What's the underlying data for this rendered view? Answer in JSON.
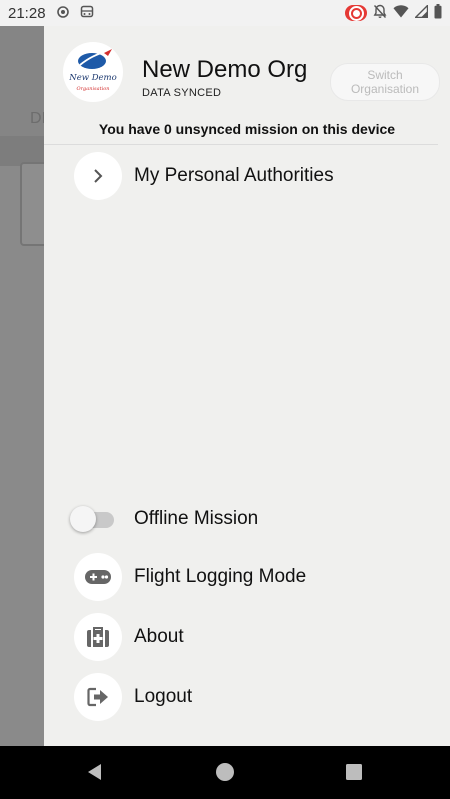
{
  "status_bar": {
    "time": "21:28",
    "icons_left": [
      "gps-icon",
      "bus-icon"
    ],
    "icons_right": [
      "screen-record-icon",
      "bell-off-icon",
      "wifi-icon",
      "signal-icon",
      "battery-icon"
    ]
  },
  "background": {
    "partial_label": "DI"
  },
  "drawer": {
    "org_name": "New Demo Org",
    "sync_status": "DATA SYNCED",
    "logo_text_1": "New Demo",
    "logo_text_2": "Organisation",
    "switch_button_line1": "Switch",
    "switch_button_line2": "Organisation",
    "unsynced_message": "You have 0 unsynced mission on this device",
    "menu_top": [
      {
        "label": "My Personal Authorities",
        "icon": "chevron-right-icon"
      }
    ],
    "offline_toggle": {
      "label": "Offline Mission",
      "on": false
    },
    "menu_bottom": [
      {
        "label": "Flight Logging Mode",
        "icon": "gamepad-icon"
      },
      {
        "label": "About",
        "icon": "first-aid-kit-icon"
      },
      {
        "label": "Logout",
        "icon": "logout-icon"
      }
    ]
  },
  "colors": {
    "drawer_bg": "#f0f0ee",
    "scrim": "#8a8a8a",
    "icon_gray": "#666666",
    "logo_blue": "#1e5aa8",
    "logo_red": "#d32f2f"
  }
}
